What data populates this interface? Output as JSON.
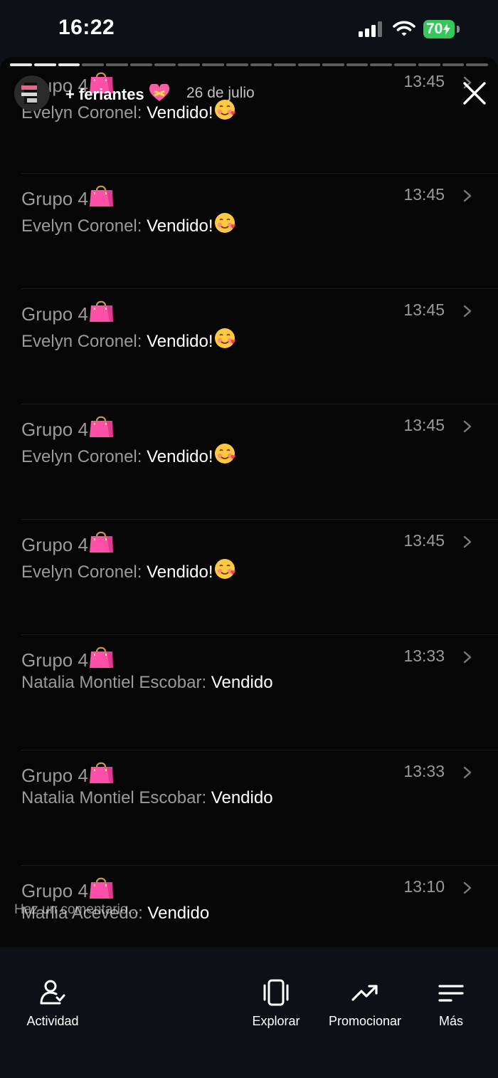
{
  "status_bar": {
    "time": "16:22",
    "battery": "70"
  },
  "story": {
    "user": "+ feriantes",
    "date": "26 de julio",
    "comment_placeholder": "Haz un comentario..."
  },
  "chats": [
    {
      "name": "Grupo 4",
      "time": "13:45",
      "sender": "Evelyn Coronel: ",
      "text": "Vendido!",
      "emoji": "smiling-face-with-hearts"
    },
    {
      "name": "Grupo 4",
      "time": "13:45",
      "sender": "Evelyn Coronel: ",
      "text": "Vendido!",
      "emoji": "smiling-face-with-hearts"
    },
    {
      "name": "Grupo 4",
      "time": "13:45",
      "sender": "Evelyn Coronel: ",
      "text": "Vendido!",
      "emoji": "smiling-face-with-hearts"
    },
    {
      "name": "Grupo 4",
      "time": "13:45",
      "sender": "Evelyn Coronel: ",
      "text": "Vendido!",
      "emoji": "smiling-face-with-hearts"
    },
    {
      "name": "Grupo 4",
      "time": "13:45",
      "sender": "Evelyn Coronel: ",
      "text": "Vendido!",
      "emoji": "smiling-face-with-hearts"
    },
    {
      "name": "Grupo 4",
      "time": "13:33",
      "sender": "Natalia Montiel Escobar: ",
      "text": "Vendido"
    },
    {
      "name": "Grupo 4",
      "time": "13:33",
      "sender": "Natalia Montiel Escobar: ",
      "text": "Vendido"
    },
    {
      "name": "Grupo 4",
      "time": "13:10",
      "sender": "Marlia Acevedo: ",
      "text": "Vendido"
    }
  ],
  "bottom_nav": {
    "activity": "Actividad",
    "explore": "Explorar",
    "promote": "Promocionar",
    "more": "Más"
  },
  "colors": {
    "battery": "#34c759",
    "background": "#0d1117",
    "story_bg": "#060606"
  }
}
